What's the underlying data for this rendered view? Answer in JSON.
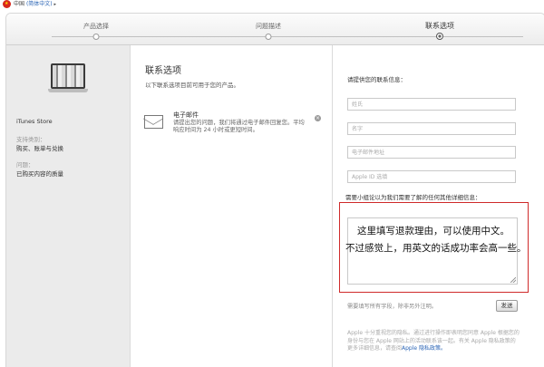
{
  "region": {
    "country": "中国",
    "language": "(简体中文)",
    "arrow": "▸"
  },
  "steps": [
    {
      "label": "产品选择",
      "active": false
    },
    {
      "label": "问题描述",
      "active": false
    },
    {
      "label": "联系选项",
      "active": true
    }
  ],
  "left": {
    "product": "iTunes Store",
    "support_label": "支持类别：",
    "support_value": "购买、账单与兑换",
    "issue_label": "问题：",
    "issue_value": "已购买内容的质量"
  },
  "contact": {
    "title": "联系选项",
    "subtitle": "以下联系选项目前可用于您的产品。",
    "email_option": {
      "title": "电子邮件",
      "description": "请提出您的问题，我们将通过电子邮件回复您。平均响应时间为 24 小时或更短时间。",
      "close": "×"
    }
  },
  "form": {
    "title": "请提供您的联系信息：",
    "fields": {
      "surname": "姓氏",
      "given_name": "名字",
      "email": "电子邮件地址",
      "apple_id": "Apple ID 选填"
    },
    "details_prompt": "需要小组论以为我们需要了解的任何其他详细信息：",
    "annotation_line1": "这里填写退款理由，可以使用中文。",
    "annotation_line2": "不过感觉上，用英文的话成功率会高一些。",
    "required_note": "需要填写所有字段，除非另外注明。",
    "send_label": "发送",
    "privacy_text": "Apple 十分重视您的隐私。通过进行操作即表明您同意 Apple 根据您的身份与您在 Apple 网站上的活动联系该一起。有关 Apple 隐私政策的更多详细信息，请查阅",
    "privacy_link": "Apple 隐私政策。"
  },
  "colors": {
    "highlight": "#cf2a2a",
    "link": "#2a64b5",
    "sidebar_bg": "#ebebeb"
  }
}
